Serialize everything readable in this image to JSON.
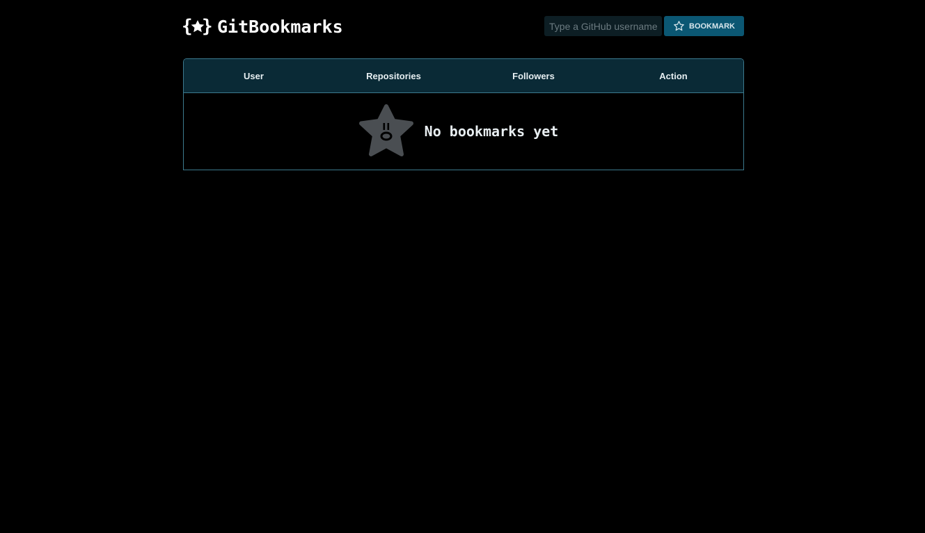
{
  "app": {
    "name": "GitBookmarks",
    "logo_icon": "braced-star-icon"
  },
  "search": {
    "placeholder": "Type a GitHub username",
    "value": ""
  },
  "bookmark_button": {
    "label": "BOOKMARK",
    "icon": "star-outline-icon"
  },
  "table": {
    "columns": [
      "User",
      "Repositories",
      "Followers",
      "Action"
    ],
    "empty_state": {
      "icon": "shocked-star-icon",
      "message": "No bookmarks yet"
    }
  },
  "colors": {
    "background": "#000000",
    "header_bg": "#0a2a36",
    "border": "#3c7a8e",
    "button_bg": "#0b5773",
    "input_bg": "#0d1e24",
    "empty_icon": "#4a4e52"
  }
}
